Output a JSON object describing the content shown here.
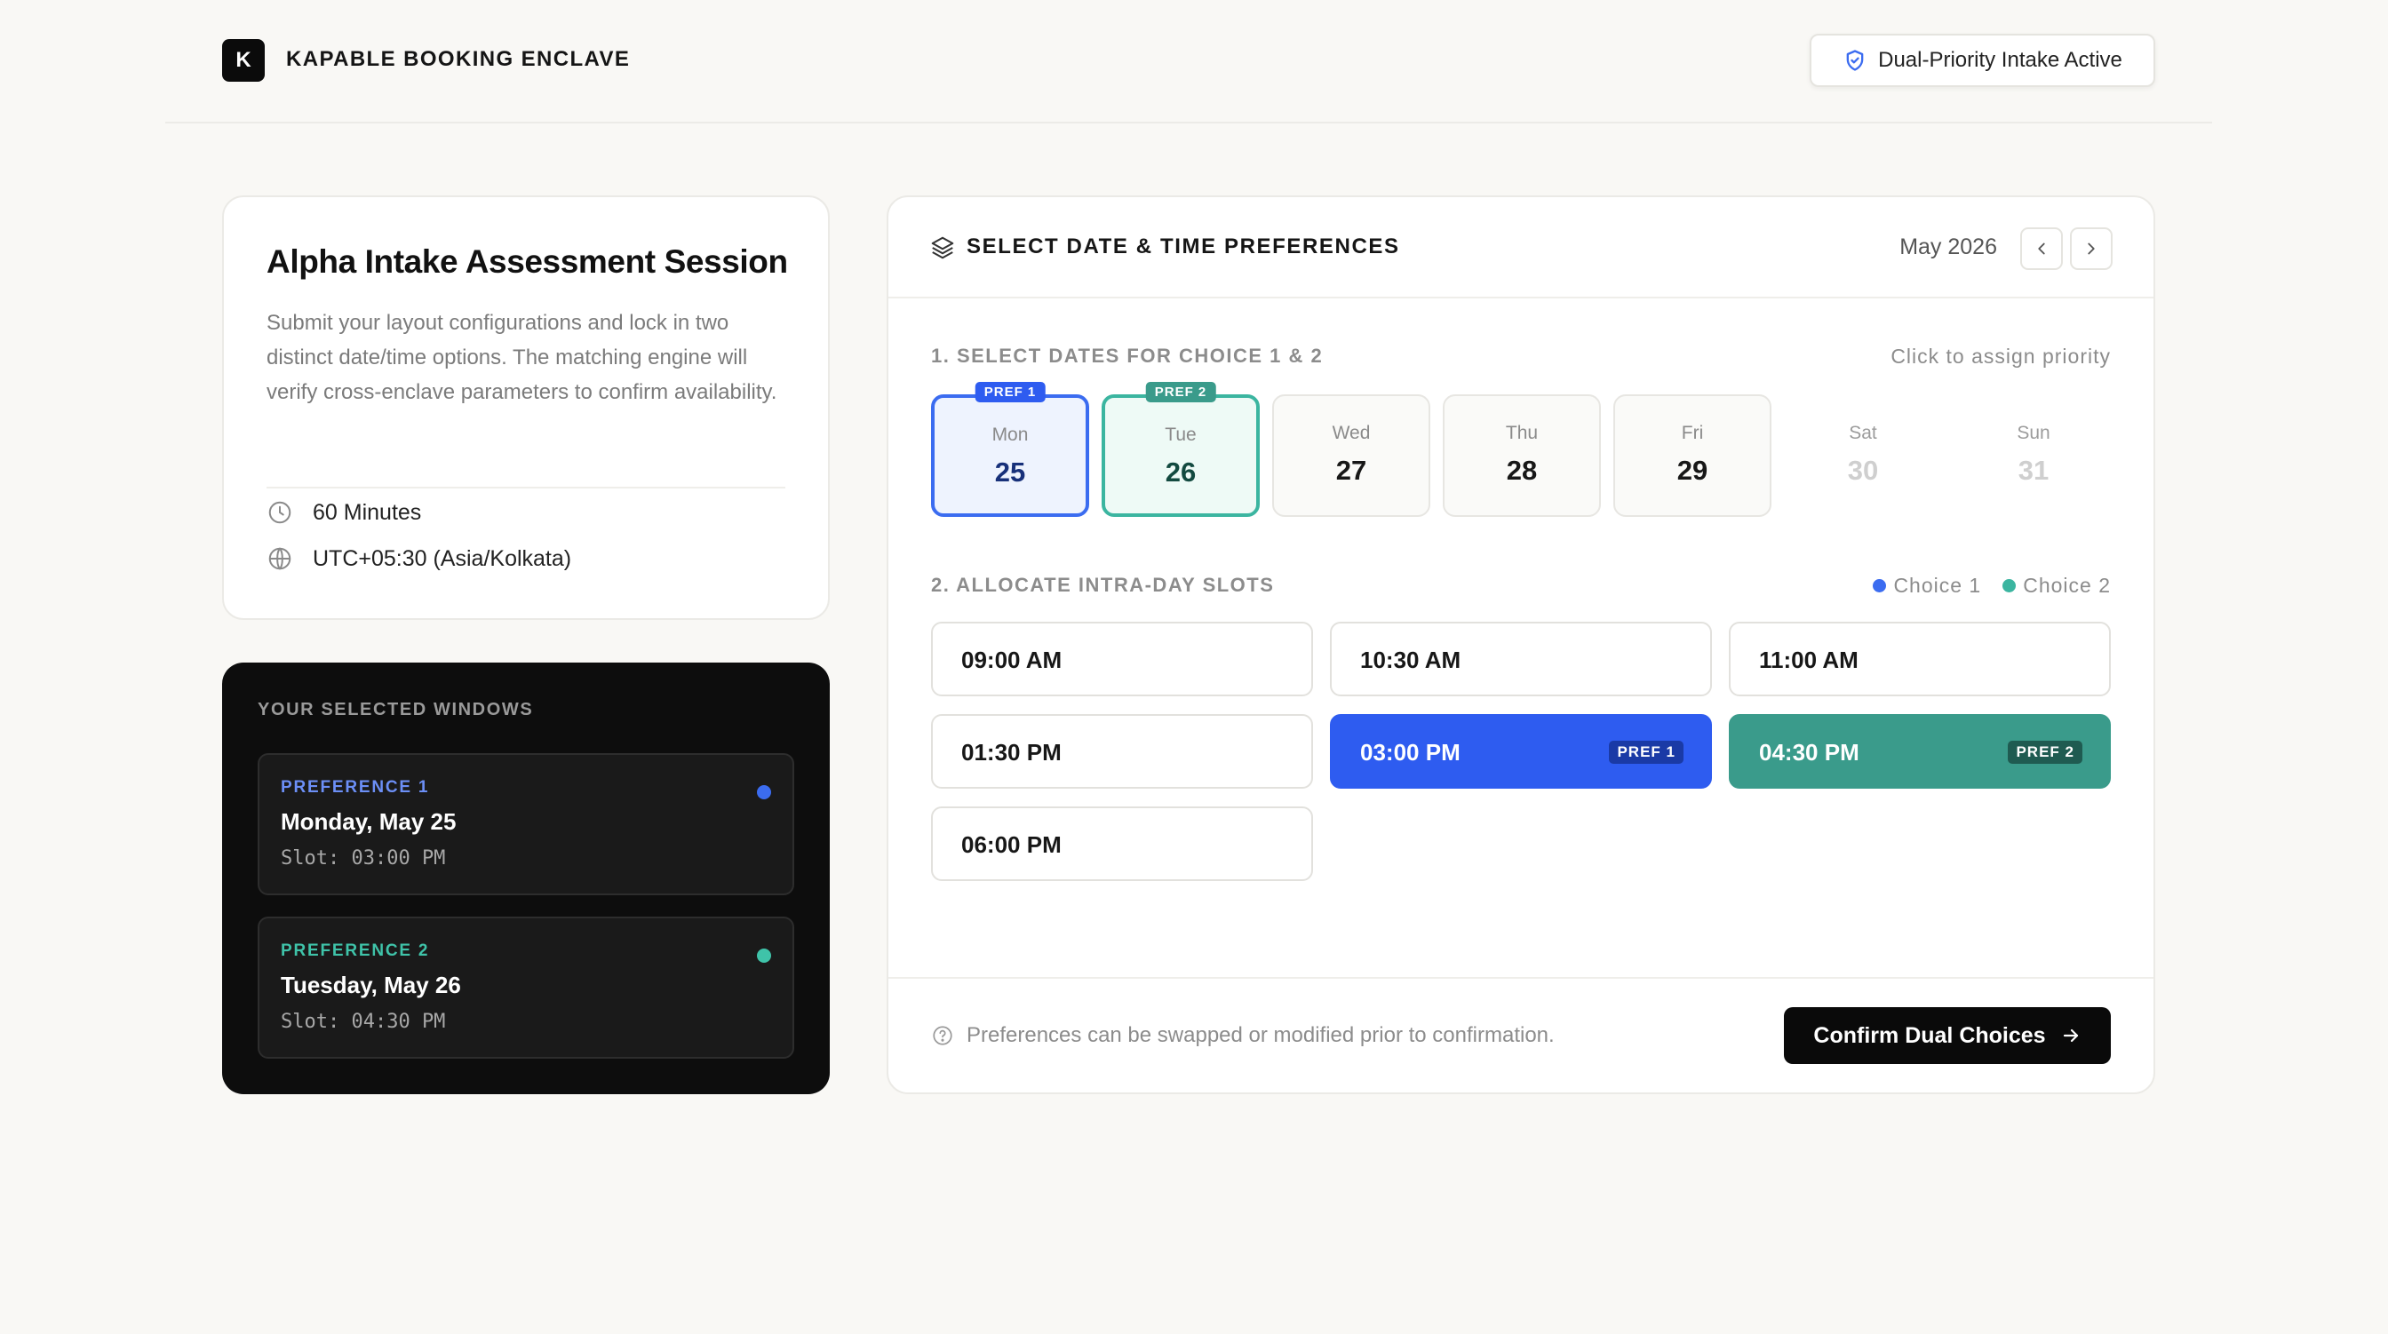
{
  "brand": {
    "logo_letter": "K",
    "name": "KAPABLE BOOKING ENCLAVE"
  },
  "status": {
    "label": "Dual-Priority Intake Active",
    "icon": "shield-check-icon"
  },
  "session": {
    "title": "Alpha Intake Assessment Session",
    "description": "Submit your layout configurations and lock in two distinct date/time options. The matching engine will verify cross-enclave parameters to confirm availability.",
    "duration": "60 Minutes",
    "timezone": "UTC+05:30 (Asia/Kolkata)"
  },
  "selected_windows": {
    "heading": "YOUR SELECTED WINDOWS",
    "preferences": [
      {
        "label": "PREFERENCE 1",
        "date": "Monday, May 25",
        "slot": "Slot: 03:00 PM",
        "color": "#3b6cf0"
      },
      {
        "label": "PREFERENCE 2",
        "date": "Tuesday, May 26",
        "slot": "Slot: 04:30 PM",
        "color": "#3fc3a9"
      }
    ]
  },
  "main": {
    "title": "SELECT DATE & TIME PREFERENCES",
    "month": "May 2026",
    "step1": {
      "label": "1. SELECT DATES FOR CHOICE 1 & 2",
      "hint": "Click to assign priority"
    },
    "days": [
      {
        "dow": "Mon",
        "num": "25",
        "state": "pref1",
        "badge": "PREF 1"
      },
      {
        "dow": "Tue",
        "num": "26",
        "state": "pref2",
        "badge": "PREF 2"
      },
      {
        "dow": "Wed",
        "num": "27",
        "state": "available"
      },
      {
        "dow": "Thu",
        "num": "28",
        "state": "available"
      },
      {
        "dow": "Fri",
        "num": "29",
        "state": "available"
      },
      {
        "dow": "Sat",
        "num": "30",
        "state": "disabled"
      },
      {
        "dow": "Sun",
        "num": "31",
        "state": "disabled"
      }
    ],
    "step2": {
      "label": "2. ALLOCATE INTRA-DAY SLOTS"
    },
    "legend": [
      {
        "label": "Choice 1",
        "color": "#3b6cf0"
      },
      {
        "label": "Choice 2",
        "color": "#3bb5a0"
      }
    ],
    "slots": [
      {
        "time": "09:00 AM"
      },
      {
        "time": "10:30 AM"
      },
      {
        "time": "11:00 AM"
      },
      {
        "time": "01:30 PM"
      },
      {
        "time": "03:00 PM",
        "badge": "PREF 1"
      },
      {
        "time": "04:30 PM",
        "badge": "PREF 2"
      },
      {
        "time": "06:00 PM"
      }
    ],
    "footer_note": "Preferences can be swapped or modified prior to confirmation.",
    "confirm_label": "Confirm Dual Choices"
  }
}
